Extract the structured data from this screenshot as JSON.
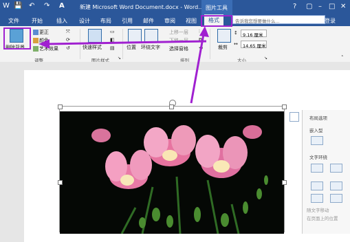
{
  "title": {
    "document": "新建 Microsoft Word Document.docx - Word...",
    "context_group": "图片工具",
    "help": "?",
    "restore": "▢",
    "minimize": "–",
    "maximize": "□",
    "close": "✕"
  },
  "qat": {
    "word": "W",
    "save": "💾",
    "undo": "↶",
    "redo": "↷",
    "format_painter": "A"
  },
  "tabs": [
    "文件",
    "开始",
    "插入",
    "设计",
    "布局",
    "引用",
    "邮件",
    "审阅",
    "视图"
  ],
  "active_tab": "格式",
  "search_placeholder": "告诉我您想要做什么...",
  "login": "登录",
  "ribbon": {
    "remove_bg": "删除背景",
    "corrections": "更正",
    "color": "颜色",
    "artistic": "艺术效果",
    "group_adjust": "调整",
    "quick_styles": "快速样式",
    "group_picstyles": "图片样式",
    "position": "位置",
    "wrap_text": "环绕文字",
    "bring_forward": "上移一层",
    "send_backward": "下移一层",
    "selection_pane": "选择窗格",
    "group_arrange": "排列",
    "crop": "裁剪",
    "height": "9.16 厘米",
    "width": "14.65 厘米",
    "group_size": "大小"
  },
  "panel": {
    "title": "布局选项",
    "inline": "嵌入型",
    "wrap": "文字环绕",
    "move_with_text": "随文字移动",
    "fix_position": "在页面上的位置"
  },
  "colors": {
    "accent": "#2b579a",
    "highlight": "#a020d0"
  }
}
